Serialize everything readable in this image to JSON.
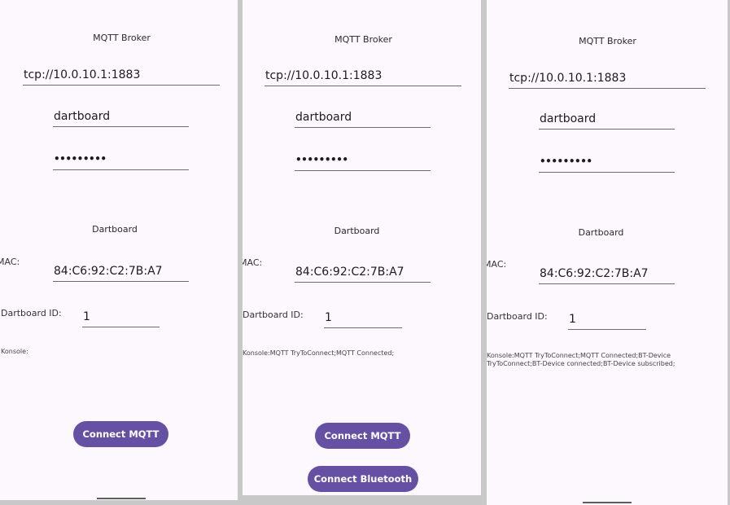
{
  "screens": [
    {
      "mqtt_title": "MQTT Broker",
      "broker_url": "tcp://10.0.10.1:1883",
      "username": "dartboard",
      "password_mask": "•••••••••",
      "dartboard_title": "Dartboard",
      "mac_label": "MAC:",
      "mac_value": "84:C6:92:C2:7B:A7",
      "dartboard_id_label": "Dartboard ID:",
      "dartboard_id_value": "1",
      "console_text": "Konsole:",
      "connect_mqtt_label": "Connect MQTT"
    },
    {
      "mqtt_title": "MQTT Broker",
      "broker_url": "tcp://10.0.10.1:1883",
      "username": "dartboard",
      "password_mask": "•••••••••",
      "dartboard_title": "Dartboard",
      "mac_label": "MAC:",
      "mac_value": "84:C6:92:C2:7B:A7",
      "dartboard_id_label": "Dartboard ID:",
      "dartboard_id_value": "1",
      "console_text": "Konsole:MQTT TryToConnect;MQTT Connected;",
      "connect_mqtt_label": "Connect MQTT",
      "connect_bluetooth_label": "Connect Bluetooth"
    },
    {
      "mqtt_title": "MQTT Broker",
      "broker_url": "tcp://10.0.10.1:1883",
      "username": "dartboard",
      "password_mask": "•••••••••",
      "dartboard_title": "Dartboard",
      "mac_label": "MAC:",
      "mac_value": "84:C6:92:C2:7B:A7",
      "dartboard_id_label": "Dartboard ID:",
      "dartboard_id_value": "1",
      "console_text": "Konsole:MQTT TryToConnect;MQTT Connected;BT-Device TryToConnect;BT-Device connected;BT-Device subscribed;"
    }
  ],
  "colors": {
    "background": "#fdf7fe",
    "button": "#6650a4",
    "button_text": "#ffffff"
  }
}
